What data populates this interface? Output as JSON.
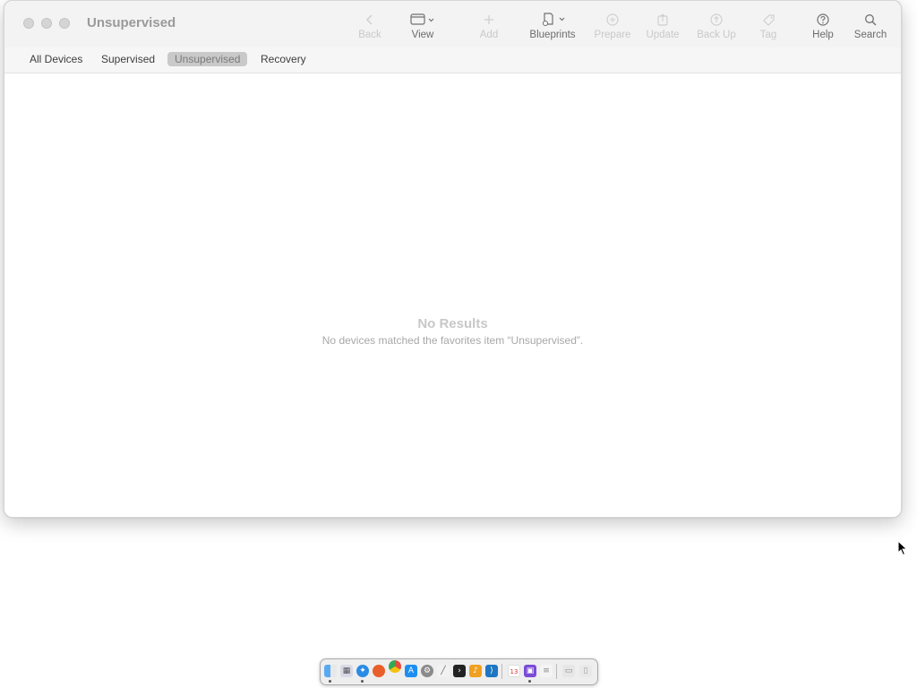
{
  "window": {
    "title": "Unsupervised"
  },
  "toolbar": {
    "back": "Back",
    "view": "View",
    "add": "Add",
    "blueprints": "Blueprints",
    "prepare": "Prepare",
    "update": "Update",
    "backup": "Back Up",
    "tag": "Tag",
    "help": "Help",
    "search": "Search"
  },
  "filters": {
    "all": "All Devices",
    "supervised": "Supervised",
    "unsupervised": "Unsupervised",
    "recovery": "Recovery"
  },
  "empty": {
    "title": "No Results",
    "subtitle": "No devices matched the favorites item “Unsupervised”."
  },
  "dock": {
    "icons": [
      "finder-icon",
      "launchpad-icon",
      "safari-icon",
      "firefox-icon",
      "chrome-icon",
      "app-store-icon",
      "system-settings-icon",
      "script-editor-icon",
      "terminal-icon",
      "garageband-icon",
      "vscode-icon",
      "calendar-icon",
      "configurator-icon",
      "notes-icon",
      "screenshot-icon",
      "trash-icon"
    ],
    "calendar_day": "13"
  },
  "colors": {
    "accent_active_filter": "#c9c9c9",
    "disabled_text": "#c9c9c9"
  }
}
